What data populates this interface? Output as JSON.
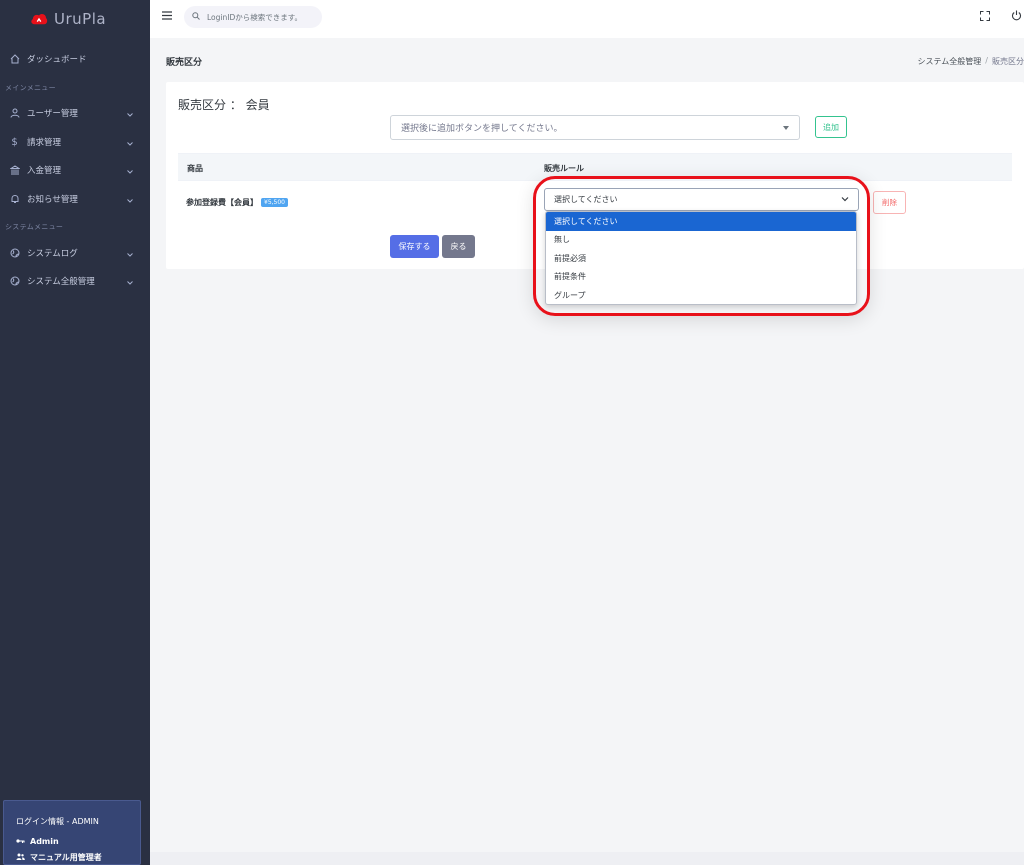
{
  "brand": {
    "name": "UruPla",
    "accent": "#e8111a"
  },
  "sidebar": {
    "dashboard": "ダッシュボード",
    "section_main": "メインメニュー",
    "items_main": [
      {
        "label": "ユーザー管理",
        "icon": "user-icon"
      },
      {
        "label": "請求管理",
        "icon": "dollar-icon"
      },
      {
        "label": "入金管理",
        "icon": "bank-icon"
      },
      {
        "label": "お知らせ管理",
        "icon": "bell-icon"
      }
    ],
    "section_system": "システムメニュー",
    "items_system": [
      {
        "label": "システムログ",
        "icon": "globe-icon"
      },
      {
        "label": "システム全般管理",
        "icon": "globe-icon"
      }
    ],
    "login": {
      "heading": "ログイン情報 - ADMIN",
      "user": "Admin",
      "role": "マニュアル用管理者"
    }
  },
  "topbar": {
    "search_placeholder": "LoginIDから検索できます。"
  },
  "page": {
    "title": "販売区分",
    "breadcrumb": [
      "システム全般管理",
      "販売区分"
    ]
  },
  "card": {
    "title": "販売区分 ： 会員",
    "add_select_placeholder": "選択後に追加ボタンを押してください。",
    "add_button": "追加",
    "table": {
      "col_product": "商品",
      "col_rule": "販売ルール",
      "row": {
        "product": "参加登録費【会員】",
        "price": "¥5,500",
        "rule_value": "選択してください",
        "delete": "削除"
      }
    },
    "save_button": "保存する",
    "back_button": "戻る"
  },
  "dropdown": {
    "options": [
      "選択してください",
      "無し",
      "前提必須",
      "前提条件",
      "グループ"
    ],
    "selected_index": 0
  }
}
